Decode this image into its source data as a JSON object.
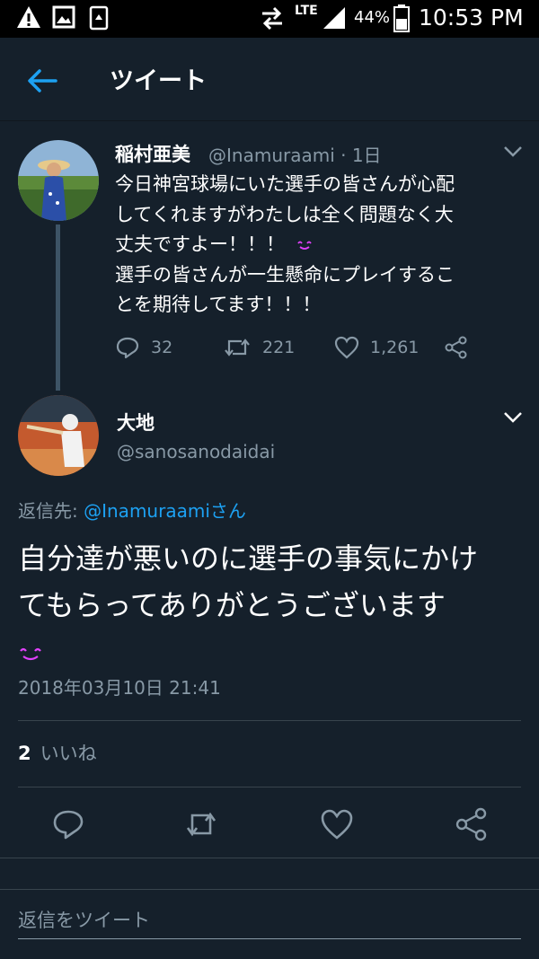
{
  "status_bar": {
    "network": "LTE",
    "battery": "44%",
    "time": "10:53 PM"
  },
  "header": {
    "title": "ツイート"
  },
  "original_tweet": {
    "name": "稲村亜美",
    "handle": "@Inamuraami · 1日",
    "lines": [
      "今日神宮球場にいた選手の皆さんが心配",
      "してくれますがわたしは全く問題なく大",
      "丈夫ですよー！！！",
      "選手の皆さんが一生懸命にプレイするこ",
      "とを期待してます！！！"
    ],
    "emoji": "😊",
    "stats": {
      "replies": "32",
      "retweets": "221",
      "likes": "1,261"
    }
  },
  "reply_tweet": {
    "name": "大地",
    "handle": "@sanosanodaidai",
    "replying_label": "返信先:",
    "replying_to": "@Inamuraamiさん",
    "lines": [
      "自分達が悪いのに選手の事気にかけ",
      "てもらってありがとうございます"
    ],
    "emoji": "😊",
    "timestamp": "2018年03月10日 21:41",
    "like_count": "2",
    "like_label": "いいね"
  },
  "reply_box": {
    "placeholder": "返信をツイート"
  },
  "colors": {
    "background": "#15202b",
    "accent": "#1da1f2",
    "muted": "#8899a6",
    "emoji": "#e040fb"
  },
  "icons": [
    "warning-icon",
    "image-icon",
    "recycle-icon",
    "data-transfer-icon",
    "signal-icon",
    "battery-icon",
    "back-arrow-icon",
    "reply-icon",
    "retweet-icon",
    "like-icon",
    "share-icon",
    "chevron-down-icon",
    "smile-emoji-icon"
  ]
}
